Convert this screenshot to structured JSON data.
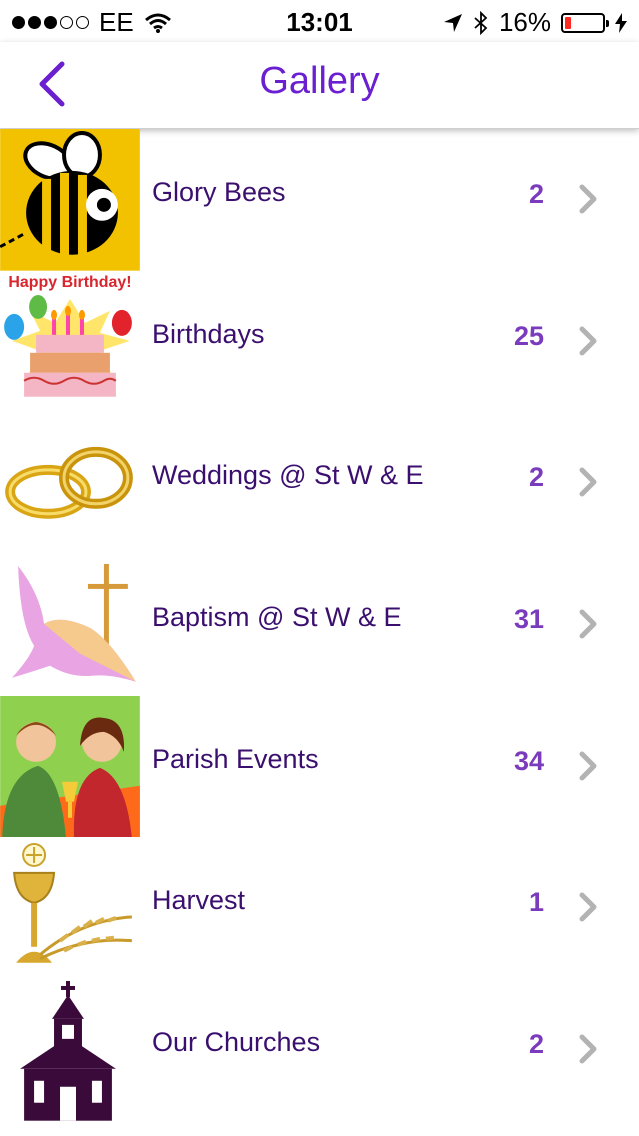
{
  "status_bar": {
    "carrier": "EE",
    "time": "13:01",
    "battery": "16%",
    "icons": [
      "signal-dots-icon",
      "wifi-icon",
      "location-arrow-icon",
      "bluetooth-icon",
      "battery-icon",
      "charging-bolt-icon"
    ]
  },
  "nav": {
    "title": "Gallery",
    "back_icon": "chevron-left-icon",
    "accent_color": "#6a1fd0"
  },
  "gallery": {
    "items": [
      {
        "label": "Glory Bees",
        "count": "2",
        "thumb": "bee-icon"
      },
      {
        "label": "Birthdays",
        "count": "25",
        "thumb": "birthday-cake-icon",
        "thumb_caption": "Happy Birthday!"
      },
      {
        "label": "Weddings @ St W & E",
        "count": "2",
        "thumb": "wedding-rings-icon"
      },
      {
        "label": "Baptism @ St W & E",
        "count": "31",
        "thumb": "dove-cross-icon"
      },
      {
        "label": "Parish Events",
        "count": "34",
        "thumb": "people-toasting-icon"
      },
      {
        "label": "Harvest",
        "count": "1",
        "thumb": "chalice-wheat-icon"
      },
      {
        "label": "Our Churches",
        "count": "2",
        "thumb": "church-icon"
      }
    ]
  }
}
